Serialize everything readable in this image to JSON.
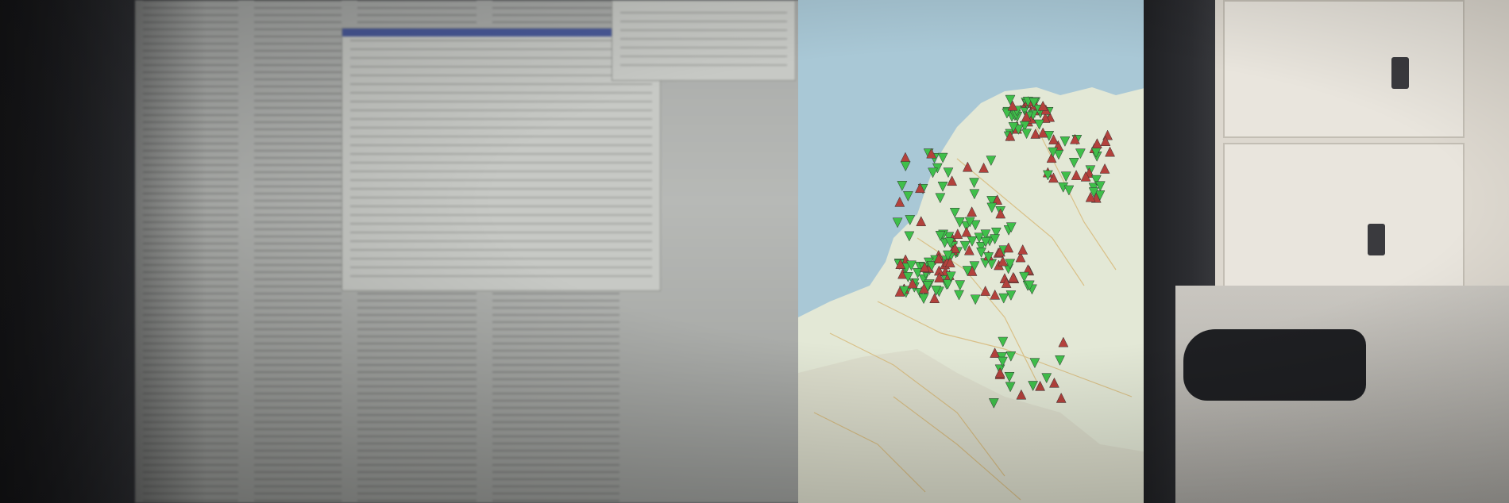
{
  "scene": {
    "description_colors": {
      "sea": "#a9c8d6",
      "land": "#e3e8d6",
      "border": "#c9a96e",
      "marker_green": "#3fbf4a",
      "marker_red": "#b3413c"
    }
  },
  "map": {
    "city_labels": [
      "",
      ""
    ]
  }
}
